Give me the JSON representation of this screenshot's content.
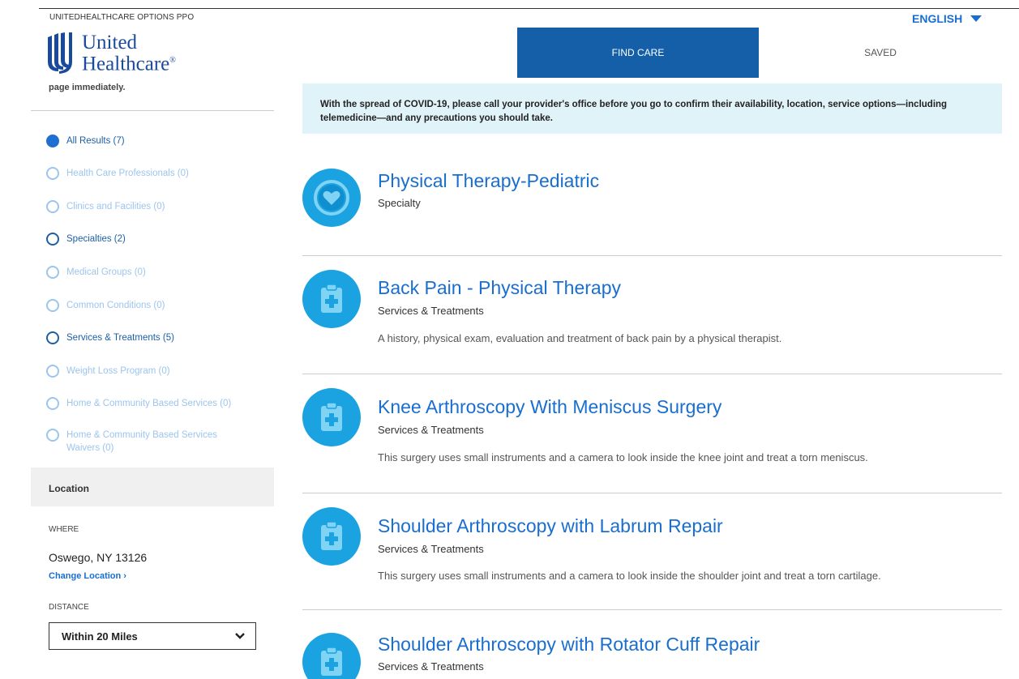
{
  "topbar": {
    "plan_name": "UNITEDHEALTHCARE OPTIONS PPO",
    "language": "ENGLISH"
  },
  "header": {
    "logo_line1": "United",
    "logo_line2": "Healthcare",
    "nav_find_care": "FIND CARE",
    "nav_saved": "SAVED"
  },
  "sidebar": {
    "truncated_text": "page immediately.",
    "filters": [
      {
        "label": "All Results (7)",
        "state": "selected"
      },
      {
        "label": "Health Care Professionals (0)",
        "state": "disabled"
      },
      {
        "label": "Clinics and Facilities (0)",
        "state": "disabled"
      },
      {
        "label": "Specialties (2)",
        "state": "enabled"
      },
      {
        "label": "Medical Groups (0)",
        "state": "disabled"
      },
      {
        "label": "Common Conditions (0)",
        "state": "disabled"
      },
      {
        "label": "Services & Treatments (5)",
        "state": "enabled"
      },
      {
        "label": "Weight Loss Program (0)",
        "state": "disabled"
      },
      {
        "label": "Home & Community Based Services (0)",
        "state": "disabled"
      },
      {
        "label": "Home & Community Based Services Waivers (0)",
        "state": "disabled"
      }
    ],
    "location": {
      "heading": "Location",
      "where_label": "WHERE",
      "where_value": "Oswego, NY 13126",
      "change_link": "Change Location",
      "distance_label": "DISTANCE",
      "distance_value": "Within 20 Miles"
    }
  },
  "notice": {
    "text": "With the spread of COVID-19, please call your provider's office before you go to confirm their availability, location, service options—including telemedicine—and any precautions you should take."
  },
  "results": [
    {
      "title": "Physical Therapy-Pediatric",
      "category": "Specialty",
      "description": "",
      "icon": "heart-icon"
    },
    {
      "title": "Back Pain - Physical Therapy",
      "category": "Services & Treatments",
      "description": "A history, physical exam, evaluation and treatment of back pain by a physical therapist.",
      "icon": "clipboard-plus-icon"
    },
    {
      "title": "Knee Arthroscopy With Meniscus Surgery",
      "category": "Services & Treatments",
      "description": "This surgery uses small instruments and a camera to look inside the knee joint and treat a torn meniscus.",
      "icon": "clipboard-plus-icon"
    },
    {
      "title": "Shoulder Arthroscopy with Labrum Repair",
      "category": "Services & Treatments",
      "description": "This surgery uses small instruments and a camera to look inside the shoulder joint and treat a torn cartilage.",
      "icon": "clipboard-plus-icon"
    },
    {
      "title": "Shoulder Arthroscopy with Rotator Cuff Repair",
      "category": "Services & Treatments",
      "description": "",
      "icon": "clipboard-plus-icon"
    }
  ],
  "colors": {
    "brand_blue": "#196ecf",
    "nav_active": "#145fa8",
    "icon_bg": "#1aa3e0",
    "notice_bg": "#e0f3f9"
  }
}
